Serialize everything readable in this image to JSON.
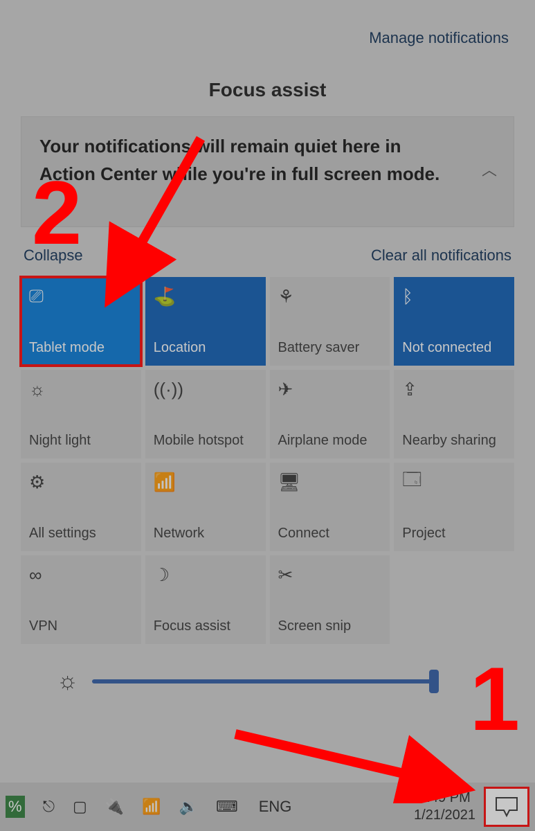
{
  "header": {
    "manage_link": "Manage notifications",
    "section_title": "Focus assist"
  },
  "notification": {
    "text": "Your notifications will remain quiet here in Action Center while you're in full screen mode."
  },
  "links": {
    "collapse": "Collapse",
    "clear_all": "Clear all notifications"
  },
  "tiles": [
    {
      "label": "Tablet mode",
      "icon": "tablet-mode-icon",
      "glyph": "⎚",
      "active": true,
      "highlighted": true
    },
    {
      "label": "Location",
      "icon": "location-icon",
      "glyph": "⛳",
      "active": true,
      "highlighted": false
    },
    {
      "label": "Battery saver",
      "icon": "battery-saver-icon",
      "glyph": "⚘",
      "active": false,
      "highlighted": false
    },
    {
      "label": "Not connected",
      "icon": "bluetooth-icon",
      "glyph": "ᛒ",
      "active": true,
      "highlighted": false
    },
    {
      "label": "Night light",
      "icon": "night-light-icon",
      "glyph": "☼",
      "active": false,
      "highlighted": false
    },
    {
      "label": "Mobile hotspot",
      "icon": "mobile-hotspot-icon",
      "glyph": "((·))",
      "active": false,
      "highlighted": false
    },
    {
      "label": "Airplane mode",
      "icon": "airplane-mode-icon",
      "glyph": "✈",
      "active": false,
      "highlighted": false
    },
    {
      "label": "Nearby sharing",
      "icon": "nearby-sharing-icon",
      "glyph": "⇪",
      "active": false,
      "highlighted": false
    },
    {
      "label": "All settings",
      "icon": "settings-icon",
      "glyph": "⚙",
      "active": false,
      "highlighted": false
    },
    {
      "label": "Network",
      "icon": "network-icon",
      "glyph": "📶",
      "active": false,
      "highlighted": false
    },
    {
      "label": "Connect",
      "icon": "connect-icon",
      "glyph": "🖥",
      "active": false,
      "highlighted": false
    },
    {
      "label": "Project",
      "icon": "project-icon",
      "glyph": "🗔",
      "active": false,
      "highlighted": false
    },
    {
      "label": "VPN",
      "icon": "vpn-icon",
      "glyph": "∞",
      "active": false,
      "highlighted": false
    },
    {
      "label": "Focus assist",
      "icon": "focus-assist-icon",
      "glyph": "☽",
      "active": false,
      "highlighted": false
    },
    {
      "label": "Screen snip",
      "icon": "screen-snip-icon",
      "glyph": "✂",
      "active": false,
      "highlighted": false
    }
  ],
  "slider": {
    "value_percent": 100
  },
  "taskbar": {
    "language": "ENG",
    "time": "6:49 PM",
    "date": "1/21/2021"
  },
  "annotations": {
    "num1": "1",
    "num2": "2"
  }
}
